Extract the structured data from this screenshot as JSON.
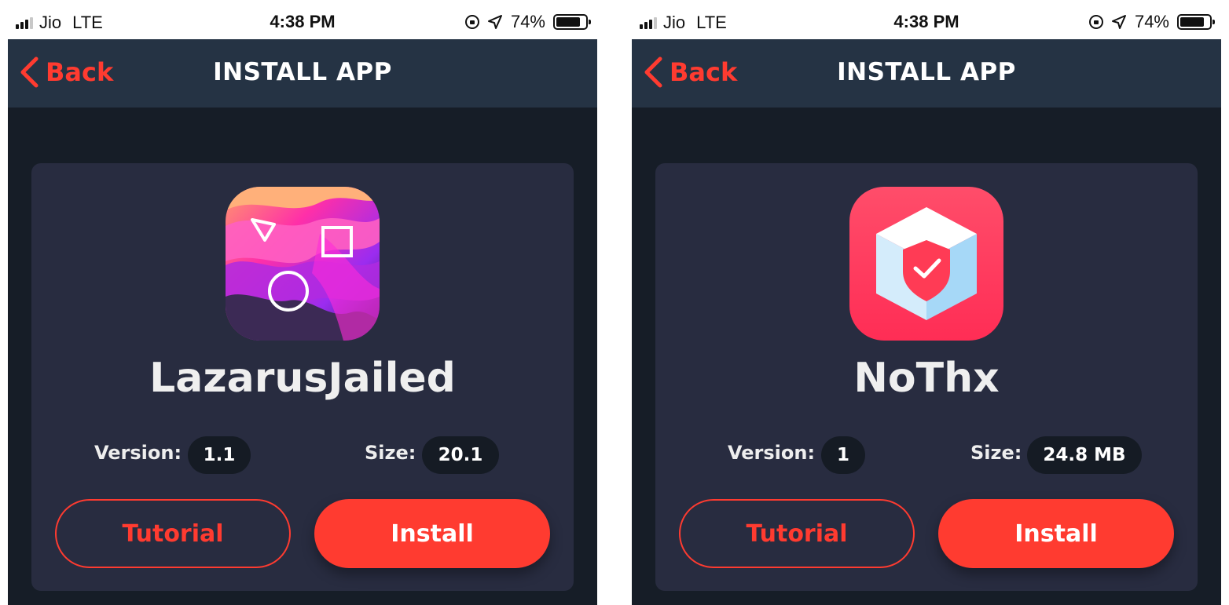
{
  "theme": {
    "accent": "#ff3b30",
    "navbar_bg": "#253344",
    "page_bg": "#161d27",
    "card_bg": "#282c40",
    "pill_bg": "#151b24"
  },
  "screens": [
    {
      "status": {
        "carrier": "Jio",
        "network": "LTE",
        "time": "4:38 PM",
        "battery": "74%",
        "battery_level": 0.74
      },
      "nav": {
        "back_label": "Back",
        "title": "INSTALL APP"
      },
      "app": {
        "name": "LazarusJailed",
        "icon": "lazarus-wave-shapes-icon",
        "version_label": "Version:",
        "version": "1.1",
        "size_label": "Size:",
        "size": "20.1"
      },
      "buttons": {
        "tutorial": "Tutorial",
        "install": "Install"
      }
    },
    {
      "status": {
        "carrier": "Jio",
        "network": "LTE",
        "time": "4:38 PM",
        "battery": "74%",
        "battery_level": 0.74
      },
      "nav": {
        "back_label": "Back",
        "title": "INSTALL APP"
      },
      "app": {
        "name": "NoThx",
        "icon": "shield-cube-icon",
        "version_label": "Version:",
        "version": "1",
        "size_label": "Size:",
        "size": "24.8 MB"
      },
      "buttons": {
        "tutorial": "Tutorial",
        "install": "Install"
      }
    }
  ]
}
